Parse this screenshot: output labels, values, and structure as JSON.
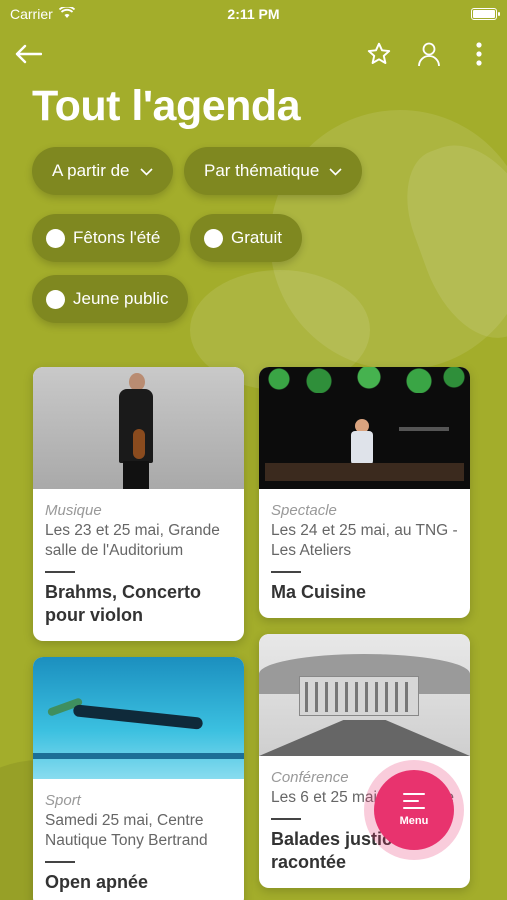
{
  "status": {
    "carrier": "Carrier",
    "time": "2:11 PM"
  },
  "header": {
    "title": "Tout l'agenda"
  },
  "filters": {
    "from_label": "A partir de",
    "theme_label": "Par thématique",
    "chips": [
      {
        "label": "Fêtons l'été"
      },
      {
        "label": "Gratuit"
      },
      {
        "label": "Jeune public"
      }
    ]
  },
  "events": [
    {
      "category": "Musique",
      "when": "Les 23 et 25 mai, Grande salle de l'Auditorium",
      "title": "Brahms, Concerto pour violon"
    },
    {
      "category": "Spectacle",
      "when": "Les 24 et 25 mai, au TNG - Les Ateliers",
      "title": "Ma Cuisine"
    },
    {
      "category": "Sport",
      "when": "Samedi 25 mai, Centre Nautique Tony Bertrand",
      "title": "Open apnée"
    },
    {
      "category": "Conférence",
      "when": "Les 6 et 25 mai, Presqu'île",
      "title": "Balades justice racontée"
    }
  ],
  "fab": {
    "label": "Menu"
  },
  "colors": {
    "background": "#a3ad2b",
    "chip": "#7f8820",
    "fab": "#e8336e"
  }
}
